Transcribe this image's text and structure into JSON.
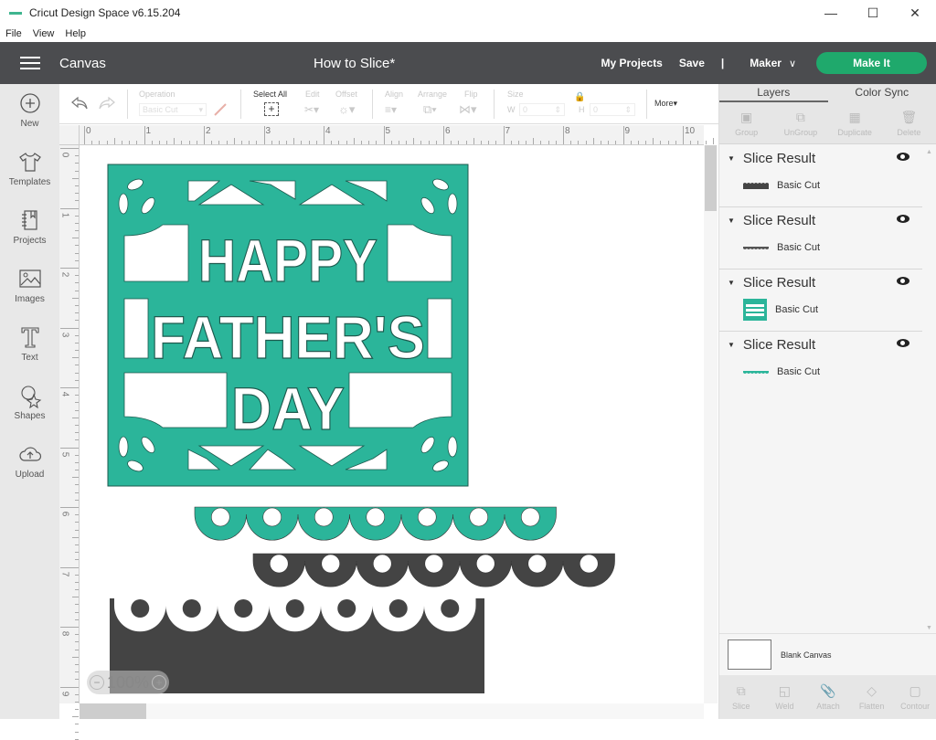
{
  "window": {
    "app_title": "Cricut Design Space  v6.15.204",
    "controls": [
      "minimize",
      "maximize",
      "close"
    ]
  },
  "menubar": {
    "items": [
      "File",
      "View",
      "Help"
    ]
  },
  "header": {
    "section": "Canvas",
    "project_title": "How to Slice*",
    "my_projects": "My Projects",
    "save": "Save",
    "divider": "|",
    "machine": "Maker",
    "make_it": "Make It",
    "colors": {
      "header_bg": "#4b4c4f",
      "make_it": "#1fa96c"
    }
  },
  "leftnav": {
    "items": [
      {
        "label": "New",
        "icon": "plus-circle-icon"
      },
      {
        "label": "Templates",
        "icon": "tshirt-icon"
      },
      {
        "label": "Projects",
        "icon": "notebook-icon"
      },
      {
        "label": "Images",
        "icon": "image-icon"
      },
      {
        "label": "Text",
        "icon": "text-icon"
      },
      {
        "label": "Shapes",
        "icon": "shapes-icon"
      },
      {
        "label": "Upload",
        "icon": "cloud-upload-icon"
      }
    ]
  },
  "toolbar": {
    "operation_label": "Operation",
    "operation_value": "Basic Cut",
    "select_all": "Select All",
    "edit": "Edit",
    "offset": "Offset",
    "align": "Align",
    "arrange": "Arrange",
    "flip": "Flip",
    "size": "Size",
    "w_label": "W",
    "w_value": "0",
    "h_label": "H",
    "h_value": "0",
    "more": "More"
  },
  "rulers": {
    "top": [
      "0",
      "1",
      "2",
      "3",
      "4",
      "5",
      "6",
      "7",
      "8",
      "9",
      "10"
    ],
    "left": [
      "0",
      "1",
      "2",
      "3",
      "4",
      "5",
      "6",
      "7",
      "8",
      "9"
    ]
  },
  "canvas": {
    "design_text": [
      "HAPPY",
      "FATHER'S",
      "DAY"
    ],
    "colors": {
      "teal": "#2bb59a",
      "dark": "#444444"
    },
    "zoom_level": "100%"
  },
  "right_panel": {
    "tabs": [
      "Layers",
      "Color Sync"
    ],
    "active_tab": "Layers",
    "actions": [
      "Group",
      "UnGroup",
      "Duplicate",
      "Delete"
    ],
    "layers": [
      {
        "name": "Slice Result",
        "operation": "Basic Cut",
        "thumb_color": "#444444",
        "visible": true
      },
      {
        "name": "Slice Result",
        "operation": "Basic Cut",
        "thumb_color": "#555555",
        "visible": true
      },
      {
        "name": "Slice Result",
        "operation": "Basic Cut",
        "thumb_color": "#2bb59a",
        "visible": true
      },
      {
        "name": "Slice Result",
        "operation": "Basic Cut",
        "thumb_color": "#2bb59a",
        "visible": true
      }
    ],
    "blank_canvas": "Blank Canvas",
    "bottom_actions": [
      "Slice",
      "Weld",
      "Attach",
      "Flatten",
      "Contour"
    ]
  }
}
